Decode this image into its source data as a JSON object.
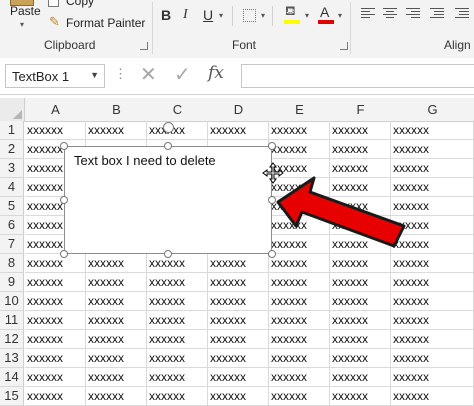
{
  "ribbon": {
    "clipboard": {
      "paste_label": "Paste",
      "copy_label": "Copy",
      "format_painter_label": "Format Painter",
      "group_label": "Clipboard"
    },
    "font": {
      "bold_label": "B",
      "italic_label": "I",
      "underline_label": "U",
      "font_color_letter": "A",
      "group_label": "Font"
    },
    "alignment": {
      "group_label": "Align"
    },
    "accent_colors": {
      "highlight": "#ffff00",
      "font_color": "#e00000"
    }
  },
  "formula_bar": {
    "name_box_value": "TextBox 1",
    "fx_label": "fx",
    "formula_value": ""
  },
  "sheet": {
    "columns": [
      "A",
      "B",
      "C",
      "D",
      "E",
      "F",
      "G"
    ],
    "rows": [
      "1",
      "2",
      "3",
      "4",
      "5",
      "6",
      "7",
      "8",
      "9",
      "10",
      "11",
      "12",
      "13",
      "14",
      "15"
    ],
    "cell_value": "xxxxxx"
  },
  "textbox": {
    "text": "Text box I need to delete",
    "annotation": "red arrow pointing to text box border"
  }
}
